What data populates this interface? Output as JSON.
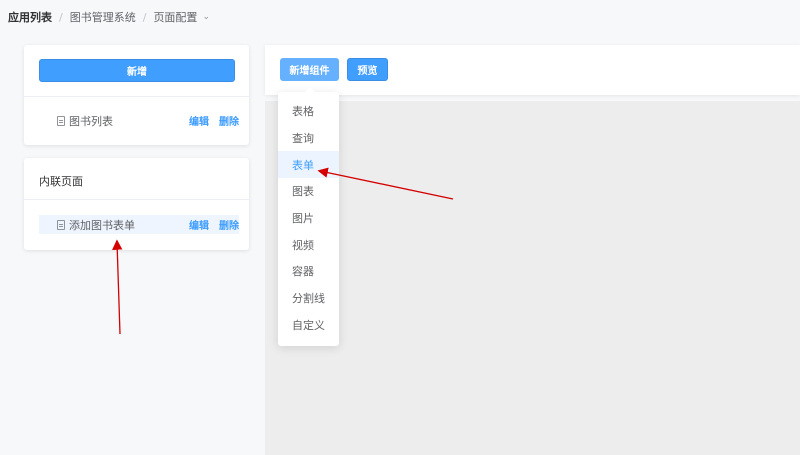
{
  "breadcrumb": {
    "root": "应用列表",
    "system": "图书管理系统",
    "current": "页面配置"
  },
  "sidebar": {
    "add_label": "新增",
    "pages": [
      {
        "name": "图书列表",
        "edit": "编辑",
        "delete": "删除"
      }
    ],
    "inline_title": "内联页面",
    "inline_pages": [
      {
        "name": "添加图书表单",
        "edit": "编辑",
        "delete": "删除"
      }
    ]
  },
  "toolbar": {
    "add_component_label": "新增组件",
    "preview_label": "预览"
  },
  "component_menu": {
    "items": [
      "表格",
      "查询",
      "表单",
      "图表",
      "图片",
      "视频",
      "容器",
      "分割线",
      "自定义"
    ],
    "highlighted": "表单"
  },
  "colors": {
    "primary": "#409eff",
    "annotation": "#d40000"
  }
}
